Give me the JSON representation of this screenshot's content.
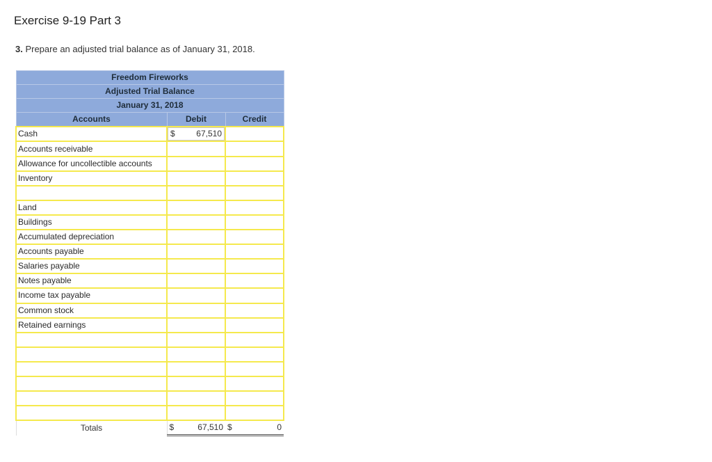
{
  "page": {
    "title": "Exercise 9-19 Part 3",
    "instruction_num": "3.",
    "instruction_text": " Prepare an adjusted trial balance as of January 31, 2018."
  },
  "table": {
    "company": "Freedom Fireworks",
    "statement": "Adjusted Trial Balance",
    "date": "January 31, 2018",
    "col_accounts": "Accounts",
    "col_debit": "Debit",
    "col_credit": "Credit",
    "rows": [
      {
        "account": "Cash",
        "debit_cur": "$",
        "debit": "67,510",
        "credit": ""
      },
      {
        "account": "Accounts receivable",
        "debit_cur": "",
        "debit": "",
        "credit": ""
      },
      {
        "account": "Allowance for uncollectible accounts",
        "debit_cur": "",
        "debit": "",
        "credit": ""
      },
      {
        "account": "Inventory",
        "debit_cur": "",
        "debit": "",
        "credit": ""
      },
      {
        "account": "",
        "debit_cur": "",
        "debit": "",
        "credit": ""
      },
      {
        "account": "Land",
        "debit_cur": "",
        "debit": "",
        "credit": ""
      },
      {
        "account": "Buildings",
        "debit_cur": "",
        "debit": "",
        "credit": ""
      },
      {
        "account": "Accumulated depreciation",
        "debit_cur": "",
        "debit": "",
        "credit": ""
      },
      {
        "account": "Accounts payable",
        "debit_cur": "",
        "debit": "",
        "credit": ""
      },
      {
        "account": "Salaries payable",
        "debit_cur": "",
        "debit": "",
        "credit": ""
      },
      {
        "account": "Notes payable",
        "debit_cur": "",
        "debit": "",
        "credit": ""
      },
      {
        "account": "Income tax payable",
        "debit_cur": "",
        "debit": "",
        "credit": ""
      },
      {
        "account": "Common stock",
        "debit_cur": "",
        "debit": "",
        "credit": ""
      },
      {
        "account": "Retained earnings",
        "debit_cur": "",
        "debit": "",
        "credit": ""
      },
      {
        "account": "",
        "debit_cur": "",
        "debit": "",
        "credit": ""
      },
      {
        "account": "",
        "debit_cur": "",
        "debit": "",
        "credit": ""
      },
      {
        "account": "",
        "debit_cur": "",
        "debit": "",
        "credit": ""
      },
      {
        "account": "",
        "debit_cur": "",
        "debit": "",
        "credit": ""
      },
      {
        "account": "",
        "debit_cur": "",
        "debit": "",
        "credit": ""
      },
      {
        "account": "",
        "debit_cur": "",
        "debit": "",
        "credit": ""
      }
    ],
    "totals": {
      "label": "Totals",
      "debit_cur": "$",
      "debit": "67,510",
      "credit_cur": "$",
      "credit": "0"
    }
  }
}
